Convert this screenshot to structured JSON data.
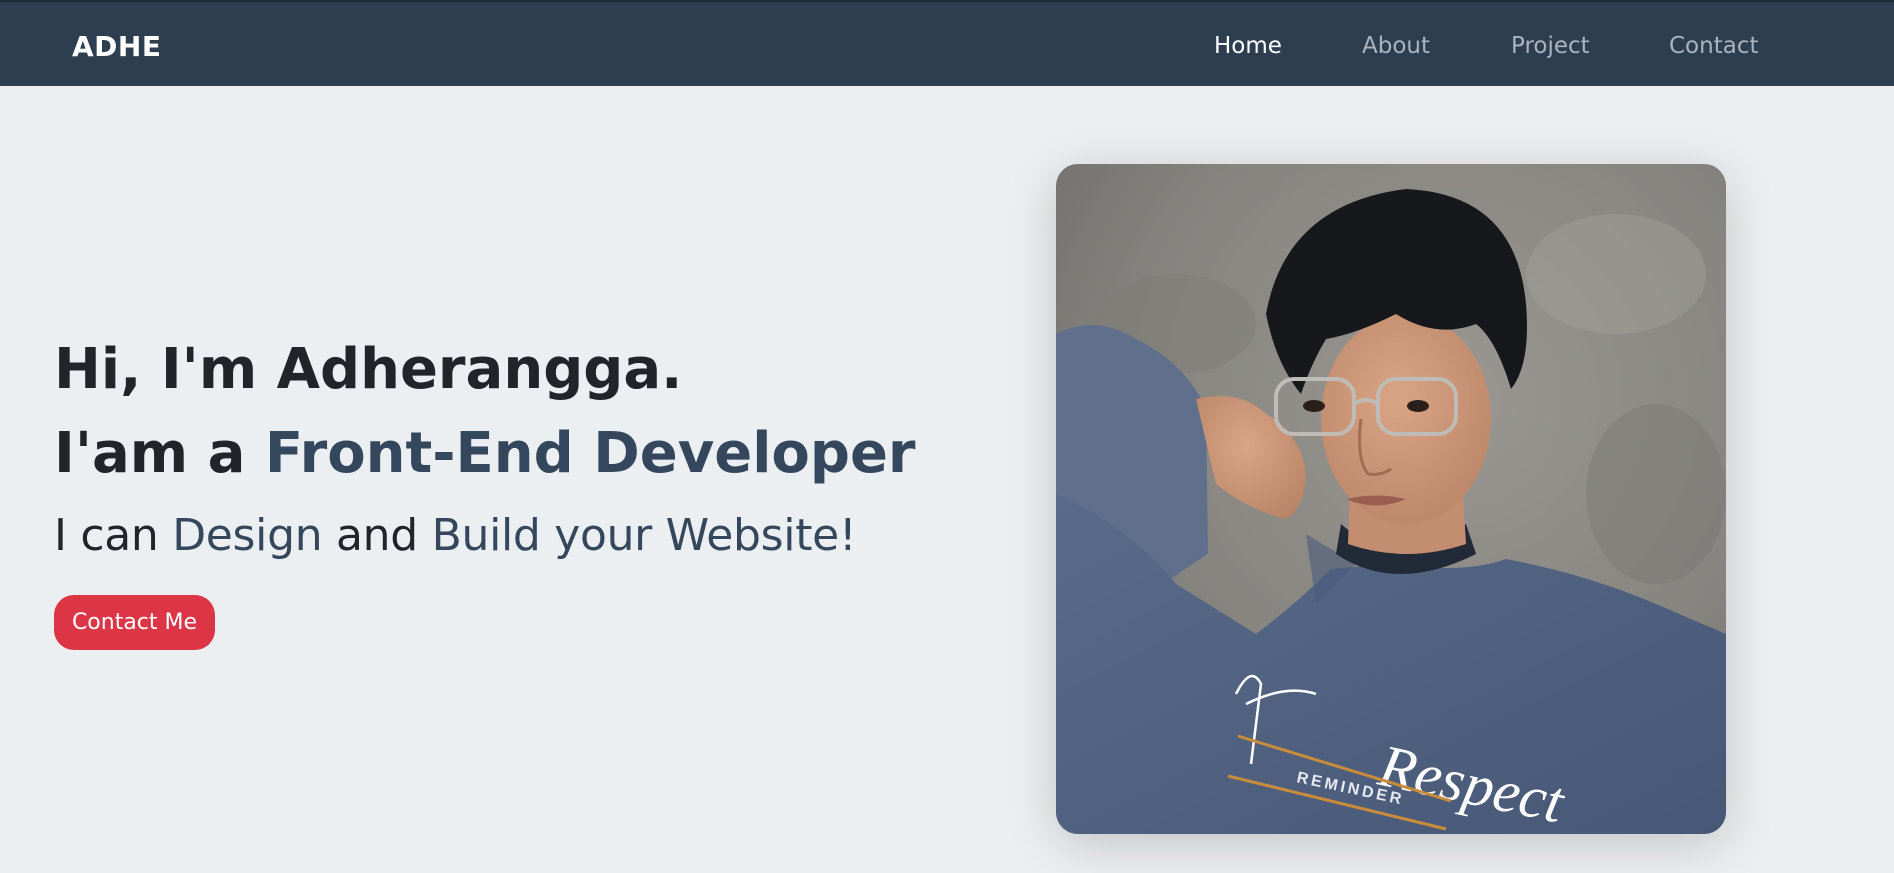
{
  "nav": {
    "brand": "ADHE",
    "links": [
      {
        "label": "Home",
        "active": true
      },
      {
        "label": "About",
        "active": false
      },
      {
        "label": "Project",
        "active": false
      },
      {
        "label": "Contact",
        "active": false
      }
    ]
  },
  "hero": {
    "greeting": "Hi, I'm Adherangga.",
    "role_prefix": "I'am a",
    "role_highlight": "Front-End Developer",
    "tagline_part1": "I can",
    "tagline_design": "Design",
    "tagline_and": "and",
    "tagline_build": "Build your Website!",
    "cta_label": "Contact Me"
  },
  "colors": {
    "navbar": "#2D3E50",
    "background": "#ECEFF1",
    "accent_text": "#34475C",
    "cta": "#DC3545"
  },
  "photo": {
    "shirt_text_1": "Respect",
    "shirt_text_2": "REMINDER"
  }
}
